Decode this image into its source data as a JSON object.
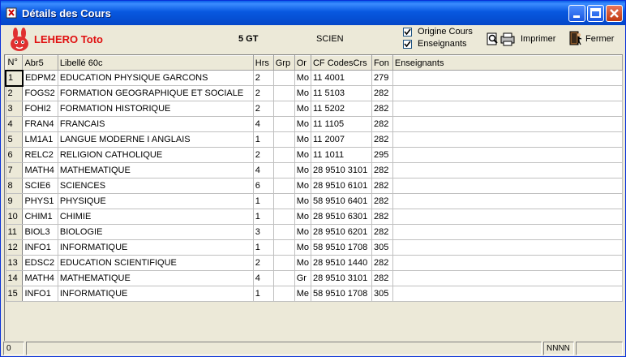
{
  "window": {
    "title": "Détails des Cours"
  },
  "header": {
    "user_name": "LEHERO Toto",
    "class_code": "5 GT",
    "section": "SCIEN",
    "options": [
      {
        "label": "Origine Cours",
        "checked": true
      },
      {
        "label": "Enseignants",
        "checked": true
      }
    ],
    "print_label": "Imprimer",
    "close_label": "Fermer"
  },
  "table": {
    "columns": [
      "N°",
      "Abr5",
      "Libellé 60c",
      "Hrs",
      "Grp",
      "Or",
      "CF CodesCrs",
      "Fon",
      "Enseignants"
    ],
    "rows": [
      [
        "1",
        "EDPM2",
        "EDUCATION PHYSIQUE GARCONS",
        "2",
        "",
        "Mo",
        "11 4001",
        "279",
        ""
      ],
      [
        "2",
        "FOGS2",
        "FORMATION GEOGRAPHIQUE ET SOCIALE",
        "2",
        "",
        "Mo",
        "11 5103",
        "282",
        ""
      ],
      [
        "3",
        "FOHI2",
        "FORMATION HISTORIQUE",
        "2",
        "",
        "Mo",
        "11 5202",
        "282",
        ""
      ],
      [
        "4",
        "FRAN4",
        "FRANCAIS",
        "4",
        "",
        "Mo",
        "11 1105",
        "282",
        ""
      ],
      [
        "5",
        "LM1A1",
        "LANGUE MODERNE I ANGLAIS",
        "1",
        "",
        "Mo",
        "11 2007",
        "282",
        ""
      ],
      [
        "6",
        "RELC2",
        "RELIGION CATHOLIQUE",
        "2",
        "",
        "Mo",
        "11 1011",
        "295",
        ""
      ],
      [
        "7",
        "MATH4",
        "MATHEMATIQUE",
        "4",
        "",
        "Mo",
        "28 9510 3101",
        "282",
        ""
      ],
      [
        "8",
        "SCIE6",
        "SCIENCES",
        "6",
        "",
        "Mo",
        "28 9510 6101",
        "282",
        ""
      ],
      [
        "9",
        "PHYS1",
        "PHYSIQUE",
        "1",
        "",
        "Mo",
        "58 9510 6401",
        "282",
        ""
      ],
      [
        "10",
        "CHIM1",
        "CHIMIE",
        "1",
        "",
        "Mo",
        "28 9510 6301",
        "282",
        ""
      ],
      [
        "11",
        "BIOL3",
        "BIOLOGIE",
        "3",
        "",
        "Mo",
        "28 9510 6201",
        "282",
        ""
      ],
      [
        "12",
        "INFO1",
        "INFORMATIQUE",
        "1",
        "",
        "Mo",
        "58 9510 1708",
        "305",
        ""
      ],
      [
        "13",
        "EDSC2",
        "EDUCATION SCIENTIFIQUE",
        "2",
        "",
        "Mo",
        "28 9510 1440",
        "282",
        ""
      ],
      [
        "14",
        "MATH4",
        "MATHEMATIQUE",
        "4",
        "",
        "Gr",
        "28 9510 3101",
        "282",
        ""
      ],
      [
        "15",
        "INFO1",
        "INFORMATIQUE",
        "1",
        "",
        "Me",
        "58 9510 1708",
        "305",
        ""
      ]
    ]
  },
  "statusbar": {
    "left": "0",
    "right": "NNNN"
  },
  "colors": {
    "title_bar": "#0858e0",
    "user_name": "#e01010",
    "window_bg": "#ece9d8"
  }
}
